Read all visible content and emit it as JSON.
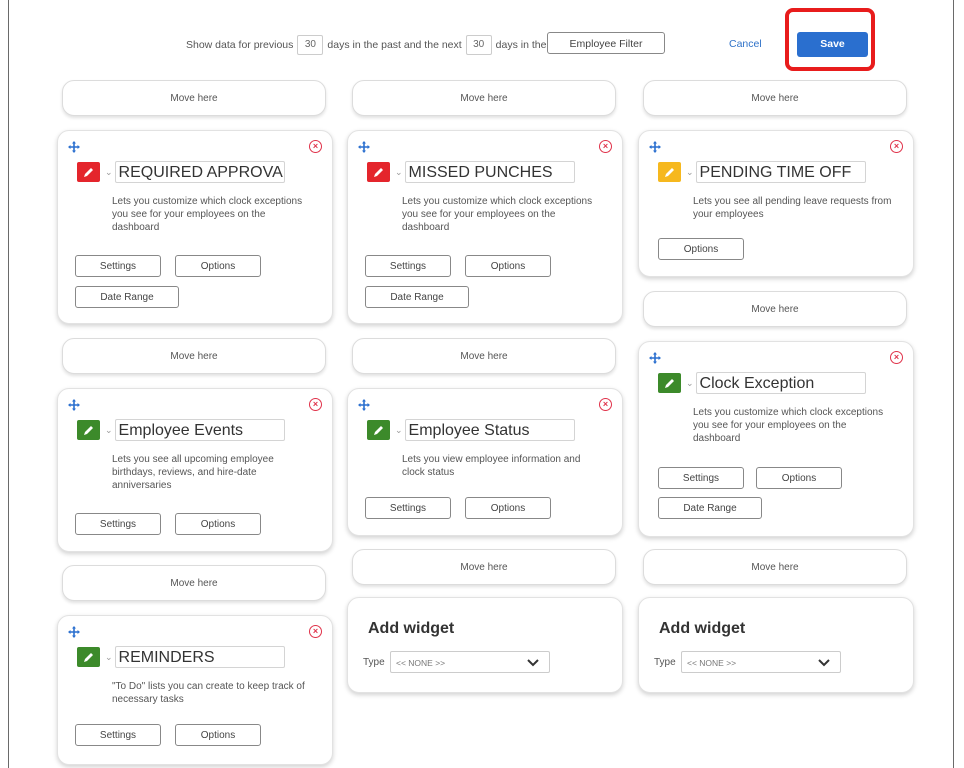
{
  "header": {
    "show_prev_label": "Show data for previous",
    "prev_days": "30",
    "mid_label": "days in the past and the next",
    "next_days": "30",
    "future_label": "days in the future",
    "employee_filter": "Employee Filter",
    "cancel": "Cancel",
    "save": "Save"
  },
  "move_here": "Move here",
  "widgets": [
    {
      "title": "REQUIRED APPROVALS",
      "icon_color": "#e4252c",
      "desc": "Lets you customize which clock exceptions you see for your employees on the dashboard",
      "settings": "Settings",
      "options": "Options",
      "date_range": "Date Range"
    },
    {
      "title": "MISSED PUNCHES",
      "icon_color": "#e4252c",
      "desc": "Lets you customize which clock exceptions you see for your employees on the dashboard",
      "settings": "Settings",
      "options": "Options",
      "date_range": "Date Range"
    },
    {
      "title": "PENDING TIME OFF",
      "icon_color": "#f6b81e",
      "desc": "Lets you see all pending leave requests from your employees",
      "options": "Options"
    },
    {
      "title": "Employee Events",
      "icon_color": "#3c8a2a",
      "desc": "Lets you see all upcoming employee birthdays, reviews, and hire-date anniversaries",
      "settings": "Settings",
      "options": "Options"
    },
    {
      "title": "Employee Status",
      "icon_color": "#3c8a2a",
      "desc": "Lets you view employee information and clock status",
      "settings": "Settings",
      "options": "Options"
    },
    {
      "title": "Clock Exception",
      "icon_color": "#3c8a2a",
      "desc": "Lets you customize which clock exceptions you see for your employees on the dashboard",
      "settings": "Settings",
      "options": "Options",
      "date_range": "Date Range"
    },
    {
      "title": "REMINDERS",
      "icon_color": "#3c8a2a",
      "desc": "\"To Do\" lists you can create to keep track of necessary tasks",
      "settings": "Settings",
      "options": "Options"
    }
  ],
  "add_widget": {
    "title": "Add widget",
    "type_label": "Type",
    "selected": "<< NONE >>"
  },
  "icons": {
    "move": "move-arrows-icon",
    "close": "close-circle-icon",
    "edit": "pencil-icon",
    "caret": "caret-down-icon",
    "chevron": "chevron-down-icon"
  },
  "colors": {
    "accent": "#2a6fcf",
    "highlight": "#e81c1c",
    "danger": "#e0334b"
  }
}
